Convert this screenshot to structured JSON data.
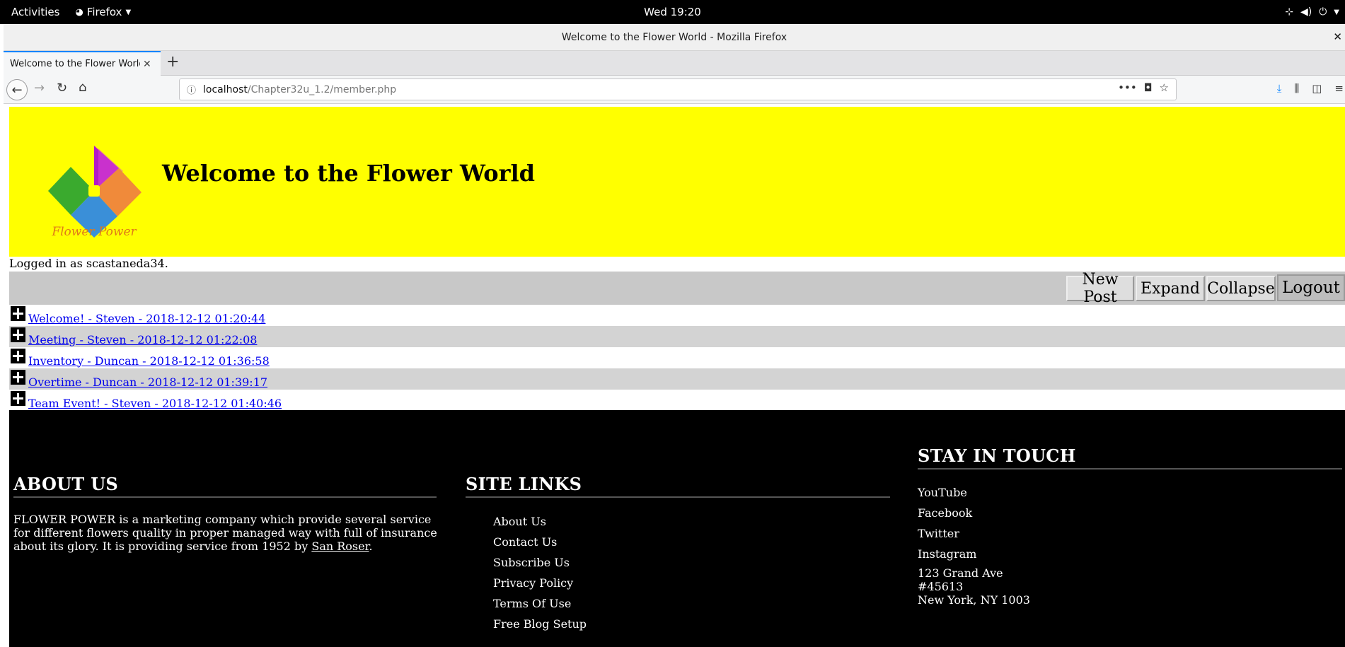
{
  "system_bar": {
    "activities": "Activities",
    "app_name": "Firefox",
    "clock": "Wed 19:20"
  },
  "window": {
    "title": "Welcome to the Flower World - Mozilla Firefox"
  },
  "browser": {
    "tab_title": "Welcome to the Flower World",
    "url_host": "localhost",
    "url_path": "/Chapter32u_1.2/member.php"
  },
  "header": {
    "logo_text": "Flower Power",
    "title": "Welcome to the Flower World"
  },
  "login_status": "Logged in as scastaneda34.",
  "toolbar": {
    "new_post": "New Post",
    "expand": "Expand",
    "collapse": "Collapse",
    "logout": "Logout"
  },
  "posts": [
    "Welcome! - Steven - 2018-12-12 01:20:44",
    "Meeting - Steven - 2018-12-12 01:22:08",
    "Inventory - Duncan - 2018-12-12 01:36:58",
    "Overtime - Duncan - 2018-12-12 01:39:17",
    "Team Event! - Steven - 2018-12-12 01:40:46"
  ],
  "footer": {
    "about": {
      "heading": "ABOUT US",
      "text": "FLOWER POWER is a marketing company which provide several service for different flowers quality in proper managed way with full of insurance about its glory. It is providing service from 1952 by ",
      "author": "San Roser",
      "text_end": "."
    },
    "site_links": {
      "heading": "SITE LINKS",
      "items": [
        "About Us",
        "Contact Us",
        "Subscribe Us",
        "Privacy Policy",
        "Terms Of Use",
        "Free Blog Setup"
      ]
    },
    "stay_in_touch": {
      "heading": "STAY IN TOUCH",
      "social": [
        "YouTube",
        "Facebook",
        "Twitter",
        "Instagram"
      ],
      "address": [
        "123 Grand Ave",
        "#45613",
        "New York, NY 1003"
      ]
    }
  },
  "colors": {
    "header_bg": "#ffff00",
    "toolbar_bg": "#c8c8c8",
    "row_alt_bg": "#d3d3d3",
    "link": "#0000ee",
    "footer_bg": "#000000"
  }
}
